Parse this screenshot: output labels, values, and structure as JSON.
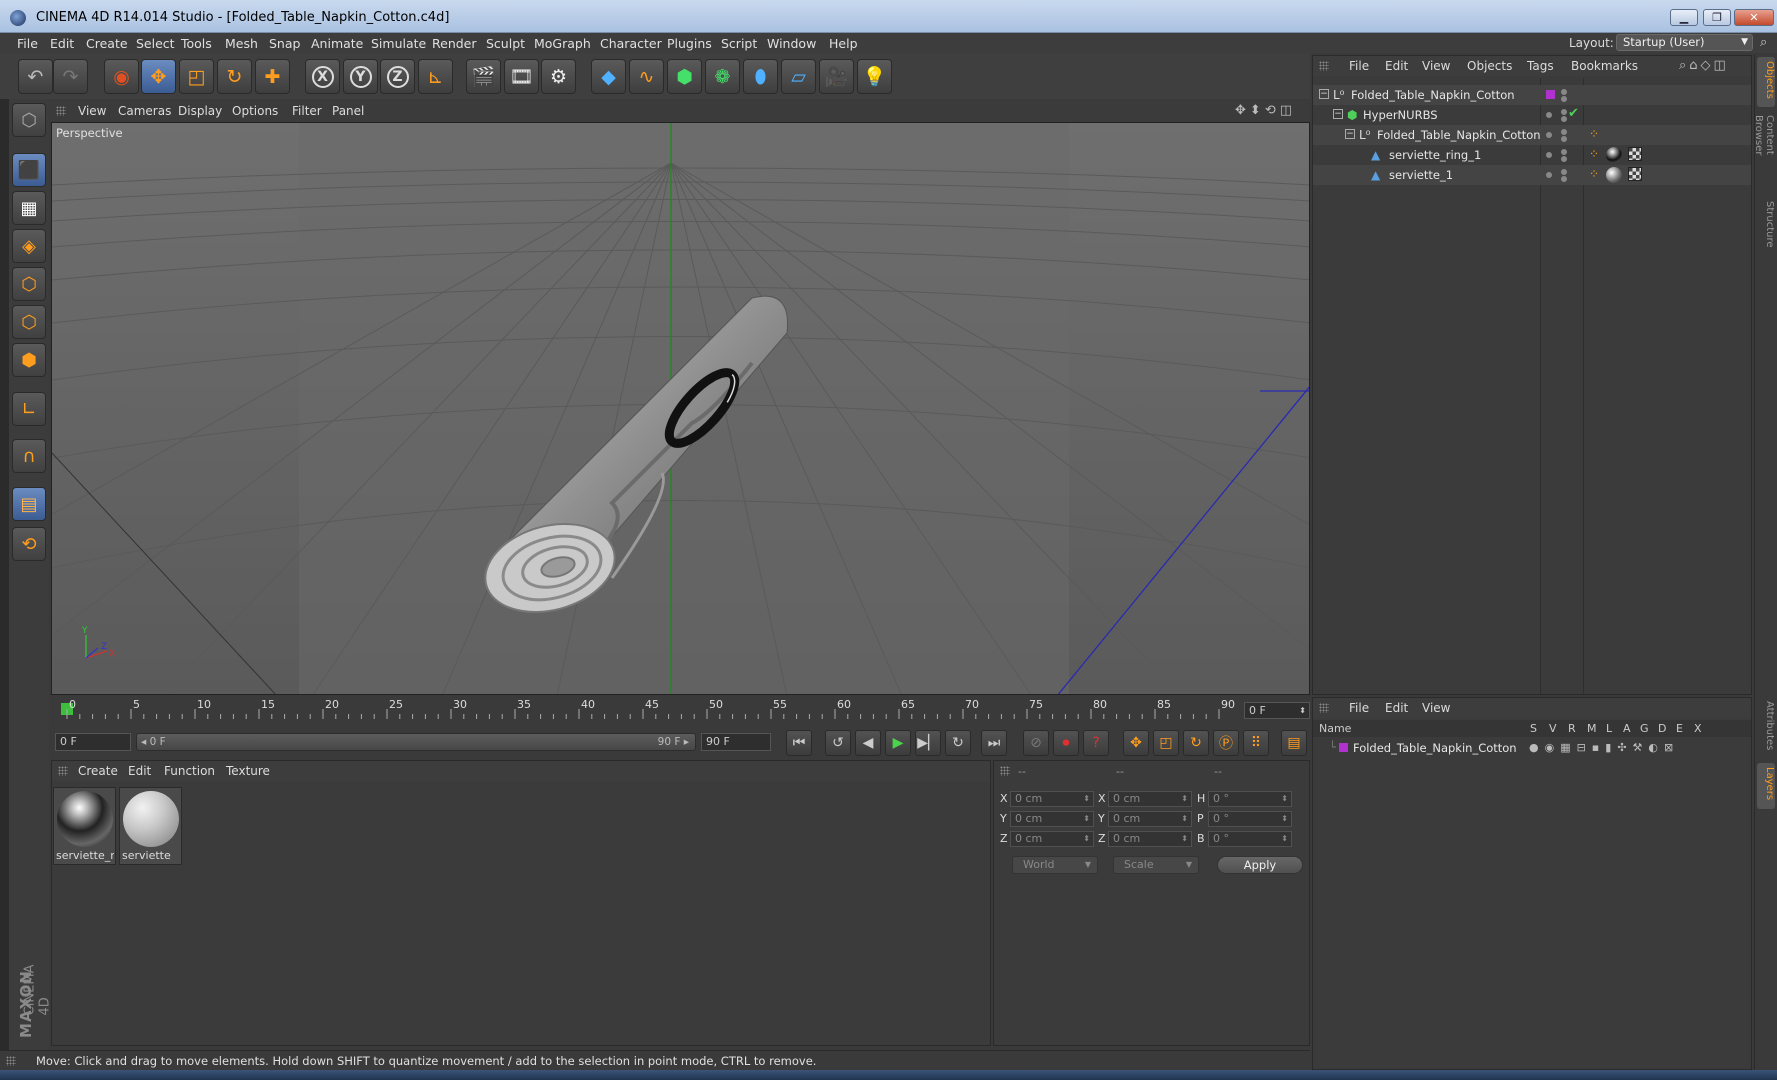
{
  "window": {
    "title": "CINEMA 4D R14.014 Studio - [Folded_Table_Napkin_Cotton.c4d]",
    "minimize": "▁",
    "maximize": "❐",
    "close": "✕"
  },
  "menubar": {
    "items": [
      "File",
      "Edit",
      "Create",
      "Select",
      "Tools",
      "Mesh",
      "Snap",
      "Animate",
      "Simulate",
      "Render",
      "Sculpt",
      "MoGraph",
      "Character",
      "Plugins",
      "Script",
      "Window",
      "Help"
    ],
    "layout_label": "Layout:",
    "layout_value": "Startup (User)"
  },
  "viewport": {
    "menu": [
      "View",
      "Cameras",
      "Display",
      "Options",
      "Filter",
      "Panel"
    ],
    "camera_label": "Perspective",
    "axis_y": "Y",
    "axis_z": "Z",
    "axis_x": "X"
  },
  "timeline": {
    "ticks": [
      "0",
      "5",
      "10",
      "15",
      "20",
      "25",
      "30",
      "35",
      "40",
      "45",
      "50",
      "55",
      "60",
      "65",
      "70",
      "75",
      "80",
      "85",
      "90"
    ],
    "current_frame": "0 F"
  },
  "playback": {
    "start_field": "0 F",
    "range_start": "◂ 0 F",
    "range_end": "90 F ▸",
    "end_field": "90 F"
  },
  "materials": {
    "menu": [
      "Create",
      "Edit",
      "Function",
      "Texture"
    ],
    "items": [
      {
        "name": "serviette_ri"
      },
      {
        "name": "serviette"
      }
    ]
  },
  "coordinates": {
    "headers": [
      "--",
      "--",
      "--"
    ],
    "rows": [
      {
        "a": "X",
        "av": "0 cm",
        "b": "X",
        "bv": "0 cm",
        "c": "H",
        "cv": "0 °"
      },
      {
        "a": "Y",
        "av": "0 cm",
        "b": "Y",
        "bv": "0 cm",
        "c": "P",
        "cv": "0 °"
      },
      {
        "a": "Z",
        "av": "0 cm",
        "b": "Z",
        "bv": "0 cm",
        "c": "B",
        "cv": "0 °"
      }
    ],
    "mode": "World",
    "transform": "Scale",
    "apply": "Apply"
  },
  "objects": {
    "menu": [
      "File",
      "Edit",
      "View",
      "Objects",
      "Tags",
      "Bookmarks"
    ],
    "tree": [
      {
        "name": "Folded_Table_Napkin_Cotton"
      },
      {
        "name": "HyperNURBS"
      },
      {
        "name": "Folded_Table_Napkin_Cotton"
      },
      {
        "name": "serviette_ring_1"
      },
      {
        "name": "serviette_1"
      }
    ]
  },
  "layers": {
    "menu": [
      "File",
      "Edit",
      "View"
    ],
    "columns": [
      "Name",
      "S",
      "V",
      "R",
      "M",
      "L",
      "A",
      "G",
      "D",
      "E",
      "X"
    ],
    "row_name": "Folded_Table_Napkin_Cotton"
  },
  "sidebar_tabs": [
    "Objects",
    "Content Browser",
    "Structure",
    "Attributes",
    "Layers"
  ],
  "brand": {
    "maxon": "MAXON",
    "c4d": "CINEMA 4D"
  },
  "status": "Move: Click and drag to move elements. Hold down SHIFT to quantize movement / add to the selection in point mode, CTRL to remove."
}
